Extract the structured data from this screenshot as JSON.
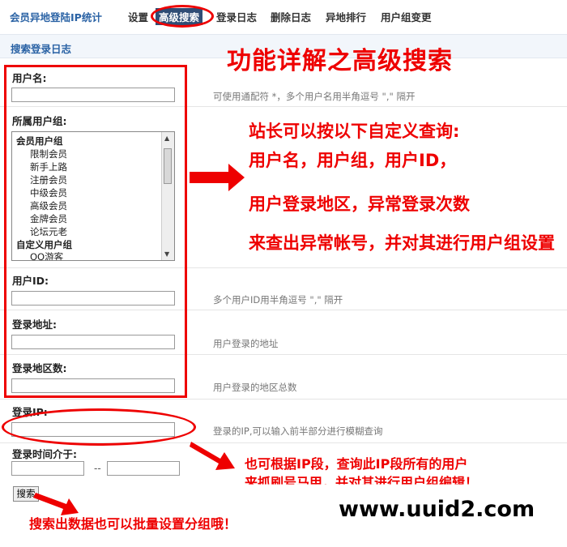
{
  "nav": {
    "plugin_title": "会员异地登陆IP统计",
    "items": [
      "设置",
      "高级搜索",
      "登录日志",
      "删除日志",
      "异地排行",
      "用户组变更"
    ],
    "active_index": 1
  },
  "section_title": "搜索登录日志",
  "form": {
    "username": {
      "label": "用户名:",
      "value": "",
      "hint": "可使用通配符 *，多个用户名用半角逗号 \",\" 隔开"
    },
    "groups": {
      "label": "所属用户组:",
      "options": [
        {
          "text": "会员用户组",
          "type": "group"
        },
        {
          "text": "限制会员",
          "type": "child"
        },
        {
          "text": "新手上路",
          "type": "child"
        },
        {
          "text": "注册会员",
          "type": "child"
        },
        {
          "text": "中级会员",
          "type": "child"
        },
        {
          "text": "高级会员",
          "type": "child"
        },
        {
          "text": "金牌会员",
          "type": "child"
        },
        {
          "text": "论坛元老",
          "type": "child"
        },
        {
          "text": "自定义用户组",
          "type": "group"
        },
        {
          "text": "QQ游客",
          "type": "child"
        }
      ]
    },
    "uid": {
      "label": "用户ID:",
      "value": "",
      "hint": "多个用户ID用半角逗号 \",\" 隔开"
    },
    "address": {
      "label": "登录地址:",
      "value": "",
      "hint": "用户登录的地址"
    },
    "regions": {
      "label": "登录地区数:",
      "value": "",
      "hint": "用户登录的地区总数"
    },
    "ip": {
      "label": "登录IP:",
      "value": "",
      "hint": "登录的IP,可以输入前半部分进行模糊查询"
    },
    "time": {
      "label": "登录时间介于:",
      "separator": "--",
      "from": "",
      "to": ""
    },
    "search_button": "搜索"
  },
  "annotations": {
    "title": "功能详解之高级搜索",
    "lines": [
      "站长可以按以下自定义查询:",
      "用户名，用户组，用户ID，",
      "用户登录地区，异常登录次数",
      "来查出异常帐号，并对其进行用户组设置"
    ],
    "ip_lines": [
      "也可根据IP段，查询此IP段所有的用户",
      "来抓刷号马甲，并对其进行用户组编辑！"
    ],
    "bottom": "搜索出数据也可以批量设置分组哦！",
    "watermark": "www.uuid2.com",
    "color": "#e00000"
  }
}
